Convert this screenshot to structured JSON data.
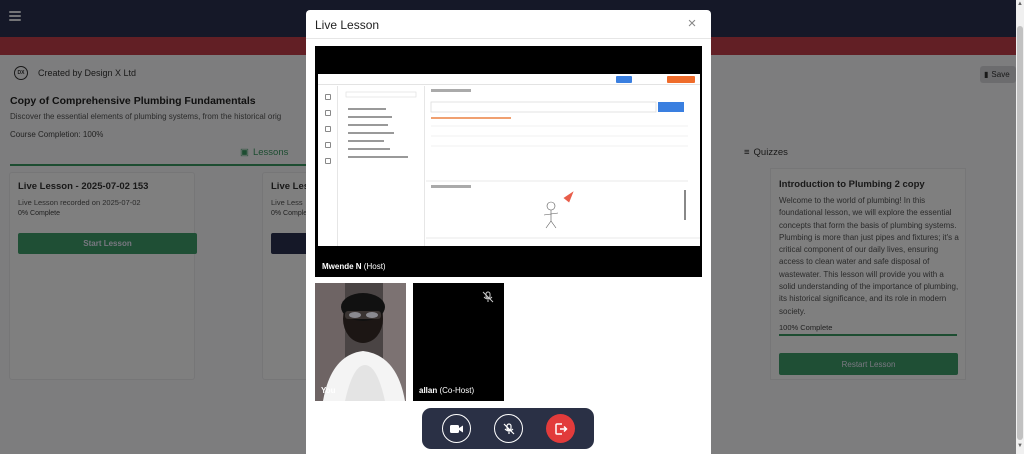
{
  "app": {
    "creator": "Created by Design X Ltd",
    "creator_logo": "DX",
    "save_label": "Save",
    "course_title": "Copy of Comprehensive Plumbing Fundamentals",
    "course_desc": "Discover the essential elements of plumbing systems, from the historical orig",
    "course_completion": "Course Completion: 100%",
    "lessons_tab": "Lessons",
    "quizzes_tab": "Quizzes",
    "lessons": [
      {
        "title": "Live Lesson - 2025-07-02 153",
        "sub": "Live Lesson recorded on 2025-07-02",
        "progress": "0% Complete",
        "button": "Start Lesson"
      },
      {
        "title": "Live Les",
        "sub": "Live Less",
        "progress": "0% Comple",
        "button": ""
      }
    ],
    "quiz": {
      "title": "Introduction to Plumbing 2 copy",
      "description": "Welcome to the world of plumbing! In this foundational lesson, we will explore the essential concepts that form the basis of plumbing systems. Plumbing is more than just pipes and fixtures; it's a critical component of our daily lives, ensuring access to clean water and safe disposal of wastewater. This lesson will provide you with a solid understanding of the importance of plumbing, its historical significance, and its role in modern society.",
      "complete": "100% Complete",
      "progress_fraction": 1.0,
      "button": "Restart Lesson"
    }
  },
  "modal": {
    "title": "Live Lesson",
    "close_icon": "close-icon",
    "host": {
      "name": "Mwende N",
      "role": "(Host)"
    },
    "participants": [
      {
        "name": "You",
        "role": ""
      },
      {
        "name": "allan",
        "role": "(Co-Host)"
      }
    ],
    "controls": {
      "camera_icon": "video-camera-icon",
      "mic_icon": "microphone-muted-icon",
      "leave_icon": "leave-call-icon"
    }
  },
  "colors": {
    "topbar": "#2a3150",
    "redband": "#c43f4a",
    "accent_green": "#3f9e6b",
    "leave_red": "#e23b3b"
  }
}
